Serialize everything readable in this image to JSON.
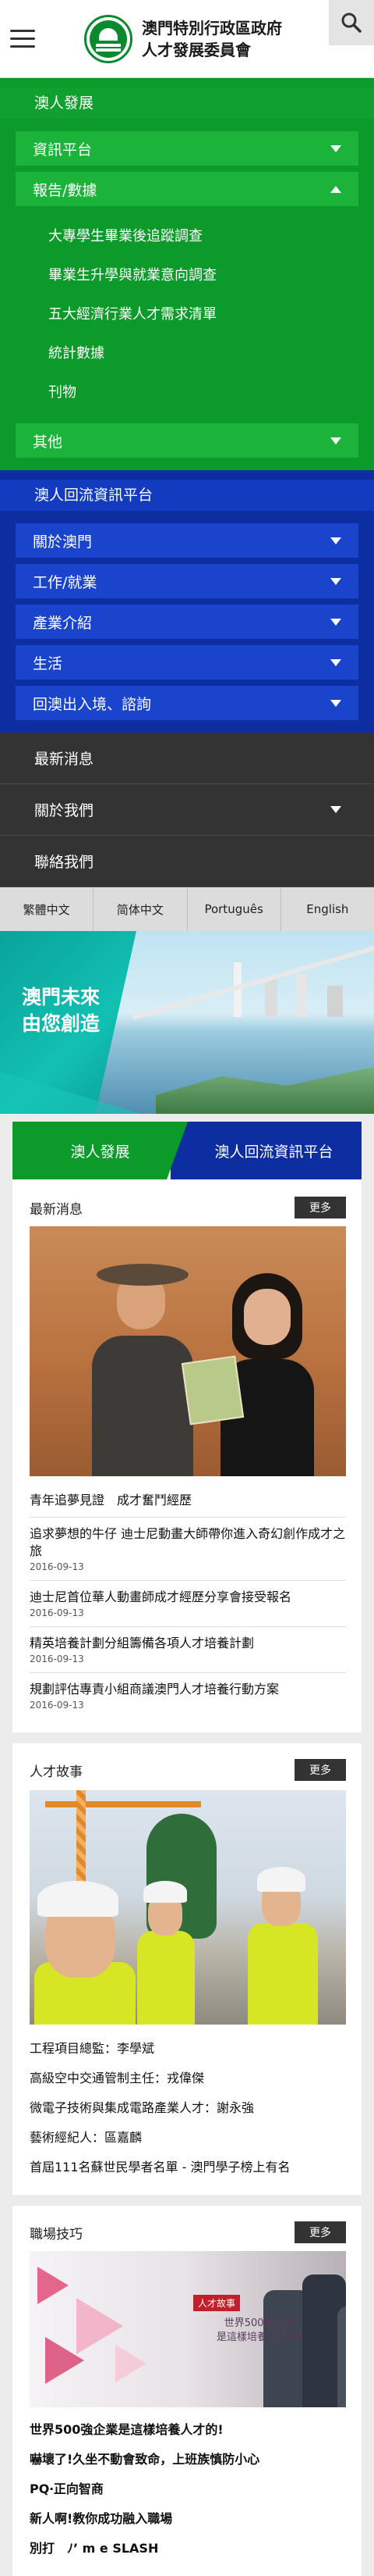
{
  "header": {
    "org_line1": "澳門特別行政區政府",
    "org_line2": "人才發展委員會"
  },
  "nav": {
    "section1": {
      "title": "澳人發展",
      "items": [
        {
          "label": "資訊平台"
        },
        {
          "label": "報告/數據"
        }
      ],
      "sub_items": [
        "大專學生畢業後追蹤調查",
        "畢業生升學與就業意向調查",
        "五大經濟行業人才需求清單",
        "統計數據",
        "刊物"
      ],
      "other": "其他"
    },
    "section2": {
      "title": "澳人回流資訊平台",
      "items": [
        {
          "label": "關於澳門"
        },
        {
          "label": "工作/就業"
        },
        {
          "label": "產業介紹"
        },
        {
          "label": "生活"
        },
        {
          "label": "回澳出入境、諮詢"
        }
      ]
    },
    "dark_items": [
      {
        "label": "最新消息",
        "chevron": false
      },
      {
        "label": "關於我們",
        "chevron": true
      },
      {
        "label": "聯絡我們",
        "chevron": false
      }
    ]
  },
  "languages": [
    "繁體中文",
    "简体中文",
    "Português",
    "English"
  ],
  "banner": {
    "slogan_line1": "澳門未來",
    "slogan_line2": "由您創造"
  },
  "tabs": {
    "left": "澳人發展",
    "right": "澳人回流資訊平台"
  },
  "news": {
    "title": "最新消息",
    "more": "更多",
    "headline": "青年追夢見證　成才奮鬥經歷",
    "items": [
      {
        "title": "追求夢想的牛仔 迪士尼動畫大師帶你進入奇幻創作成才之旅",
        "date": "2016-09-13"
      },
      {
        "title": "迪士尼首位華人動畫師成才經歷分享會接受報名",
        "date": "2016-09-13"
      },
      {
        "title": "精英培養計劃分組籌備各項人才培養計劃",
        "date": "2016-09-13"
      },
      {
        "title": "規劃評估專責小組商議澳門人才培養行動方案",
        "date": "2016-09-13"
      }
    ]
  },
  "stories": {
    "title": "人才故事",
    "more": "更多",
    "headline": "工程項目總監：李學斌",
    "items": [
      "高級空中交通管制主任：戎偉傑",
      "微電子技術與集成電路產業人才：謝永強",
      "藝術經紀人：區嘉麟",
      "首屆111名蘇世民學者名單 - 澳門學子榜上有名"
    ]
  },
  "tips": {
    "title": "職場技巧",
    "more": "更多",
    "image_badge": "人才故事",
    "image_caption_line1": "世界500強企業",
    "image_caption_line2": "是這樣培養人才的!",
    "headline": "世界500強企業是這樣培養人才的!",
    "items": [
      "嚇壞了!久坐不動會致命，上班族慎防小心",
      "PQ‧正向智商",
      "新人啊!教你成功融入職場",
      "別打　ﾉ’ m e SLASH"
    ]
  },
  "colors": {
    "green": "#0c9a2b",
    "blue": "#0d2ea0",
    "dark": "#333333"
  }
}
